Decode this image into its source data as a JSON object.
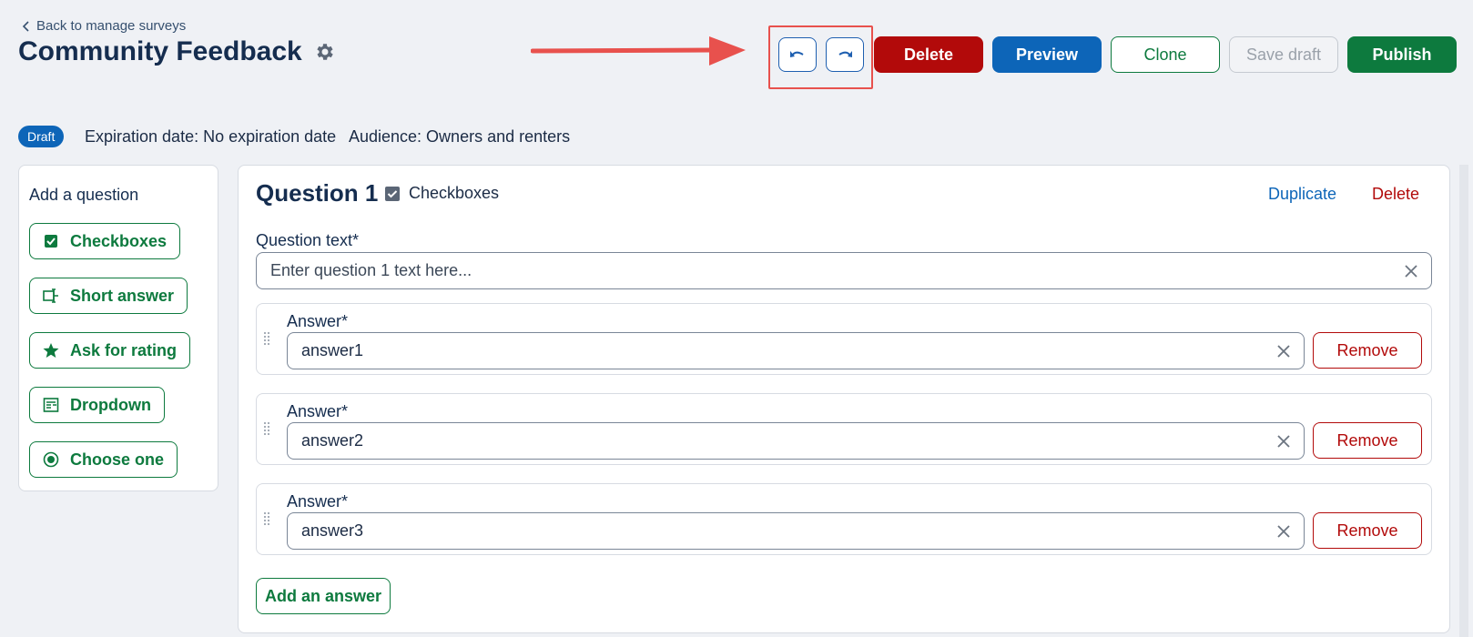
{
  "header": {
    "back_label": "Back to manage surveys",
    "title": "Community Feedback"
  },
  "toolbar": {
    "undo_icon": "undo-icon",
    "redo_icon": "redo-icon",
    "delete_label": "Delete",
    "preview_label": "Preview",
    "clone_label": "Clone",
    "save_draft_label": "Save draft",
    "publish_label": "Publish"
  },
  "meta": {
    "status_badge": "Draft",
    "expiration": "Expiration date: No expiration date",
    "audience": "Audience: Owners and renters"
  },
  "sidebar": {
    "title": "Add a question",
    "items": [
      {
        "label": "Checkboxes",
        "icon": "checkbox-icon"
      },
      {
        "label": "Short answer",
        "icon": "text-input-icon"
      },
      {
        "label": "Ask for rating",
        "icon": "star-icon"
      },
      {
        "label": "Dropdown",
        "icon": "dropdown-icon"
      },
      {
        "label": "Choose one",
        "icon": "radio-icon"
      }
    ]
  },
  "question": {
    "title": "Question 1",
    "type_label": "Checkboxes",
    "duplicate_label": "Duplicate",
    "delete_label": "Delete",
    "text_label": "Question text*",
    "text_placeholder": "Enter question 1 text here...",
    "answers": [
      {
        "label": "Answer*",
        "value": "answer1",
        "remove_label": "Remove"
      },
      {
        "label": "Answer*",
        "value": "answer2",
        "remove_label": "Remove"
      },
      {
        "label": "Answer*",
        "value": "answer3",
        "remove_label": "Remove"
      }
    ],
    "add_answer_label": "Add an answer"
  },
  "colors": {
    "danger": "#b20a0a",
    "primary": "#0d65b8",
    "success": "#0d7a3e",
    "annotation": "#e8514d"
  }
}
